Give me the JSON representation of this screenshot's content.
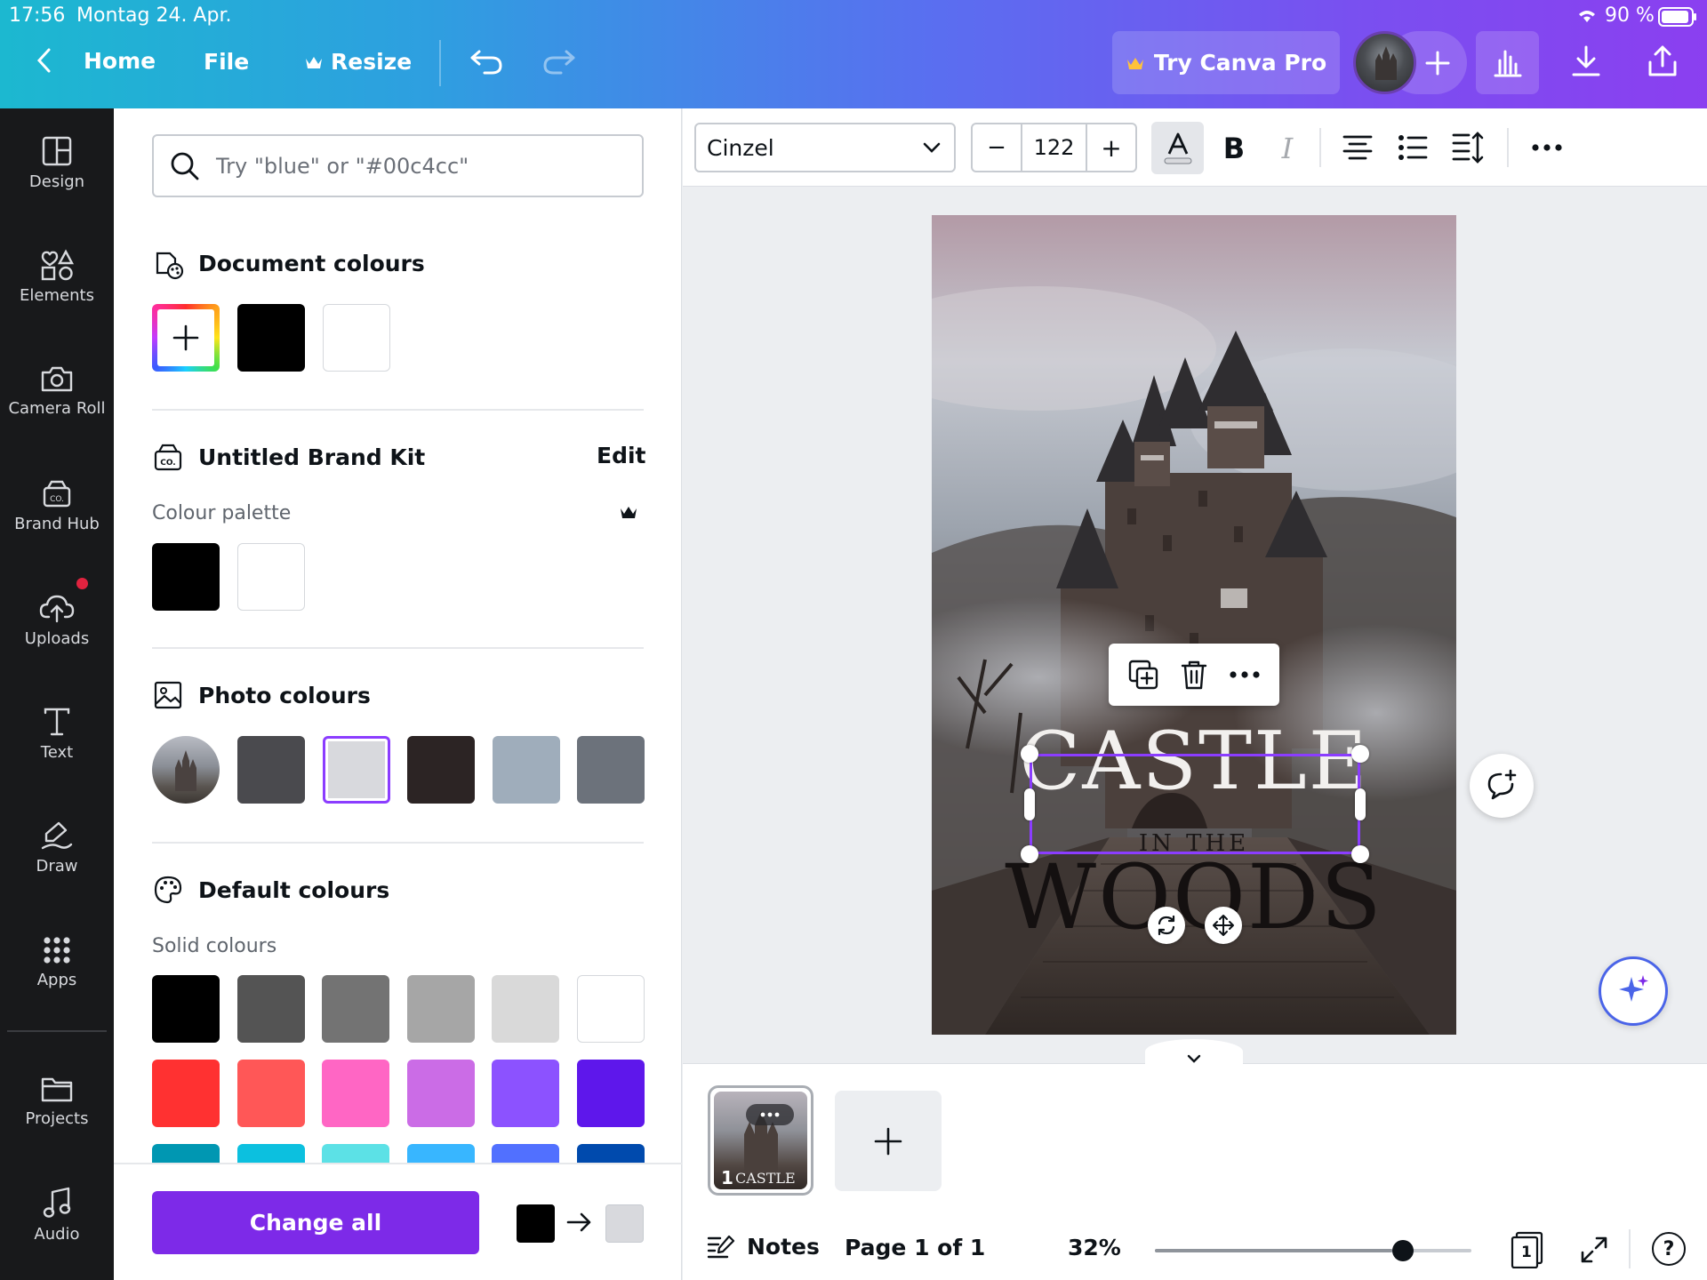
{
  "status": {
    "time": "17:56",
    "date": "Montag 24. Apr.",
    "battery": "90 %"
  },
  "topbar": {
    "home": "Home",
    "file": "File",
    "resize": "Resize",
    "try_pro": "Try Canva Pro"
  },
  "nav": {
    "design": "Design",
    "elements": "Elements",
    "camera_roll": "Camera Roll",
    "brand_hub": "Brand Hub",
    "uploads": "Uploads",
    "text": "Text",
    "draw": "Draw",
    "apps": "Apps",
    "projects": "Projects",
    "audio": "Audio"
  },
  "panel": {
    "search_placeholder": "Try \"blue\" or \"#00c4cc\"",
    "document_colours": "Document colours",
    "document_swatches": [
      "#000000",
      "#ffffff"
    ],
    "brand_kit": "Untitled Brand Kit",
    "edit": "Edit",
    "colour_palette": "Colour palette",
    "palette_swatches": [
      "#000000",
      "#ffffff"
    ],
    "photo_colours": "Photo colours",
    "photo_swatches": [
      "#4a4a4e",
      "#d8d9dd",
      "#2c2424",
      "#9fadbb",
      "#6c727b"
    ],
    "default_colours": "Default colours",
    "solid_colours": "Solid colours",
    "solid_row1": [
      "#000000",
      "#545454",
      "#737373",
      "#a6a6a6",
      "#d9d9d9",
      "#ffffff"
    ],
    "solid_row2": [
      "#ff3131",
      "#ff5757",
      "#ff66c4",
      "#cb6ce6",
      "#8c52ff",
      "#5e17eb"
    ],
    "solid_row3": [
      "#0097b2",
      "#0cc0df",
      "#5ce1e6",
      "#38b6ff",
      "#5170ff",
      "#004aad"
    ],
    "change_all": "Change all",
    "change_from": "#000000",
    "change_to": "#d8d9dd"
  },
  "toolbar": {
    "font": "Cinzel",
    "font_size": "122",
    "minus": "−",
    "plus": "+"
  },
  "canvas": {
    "title_line1": "CASTLE",
    "title_line2": "IN THE",
    "title_line3": "WOODS"
  },
  "pages": {
    "thumb_number": "1",
    "thumb_text": "CASTLE",
    "notes": "Notes",
    "page_info": "Page 1 of 1",
    "zoom": "32%",
    "zoom_fraction": 0.32,
    "page_count": "1"
  }
}
